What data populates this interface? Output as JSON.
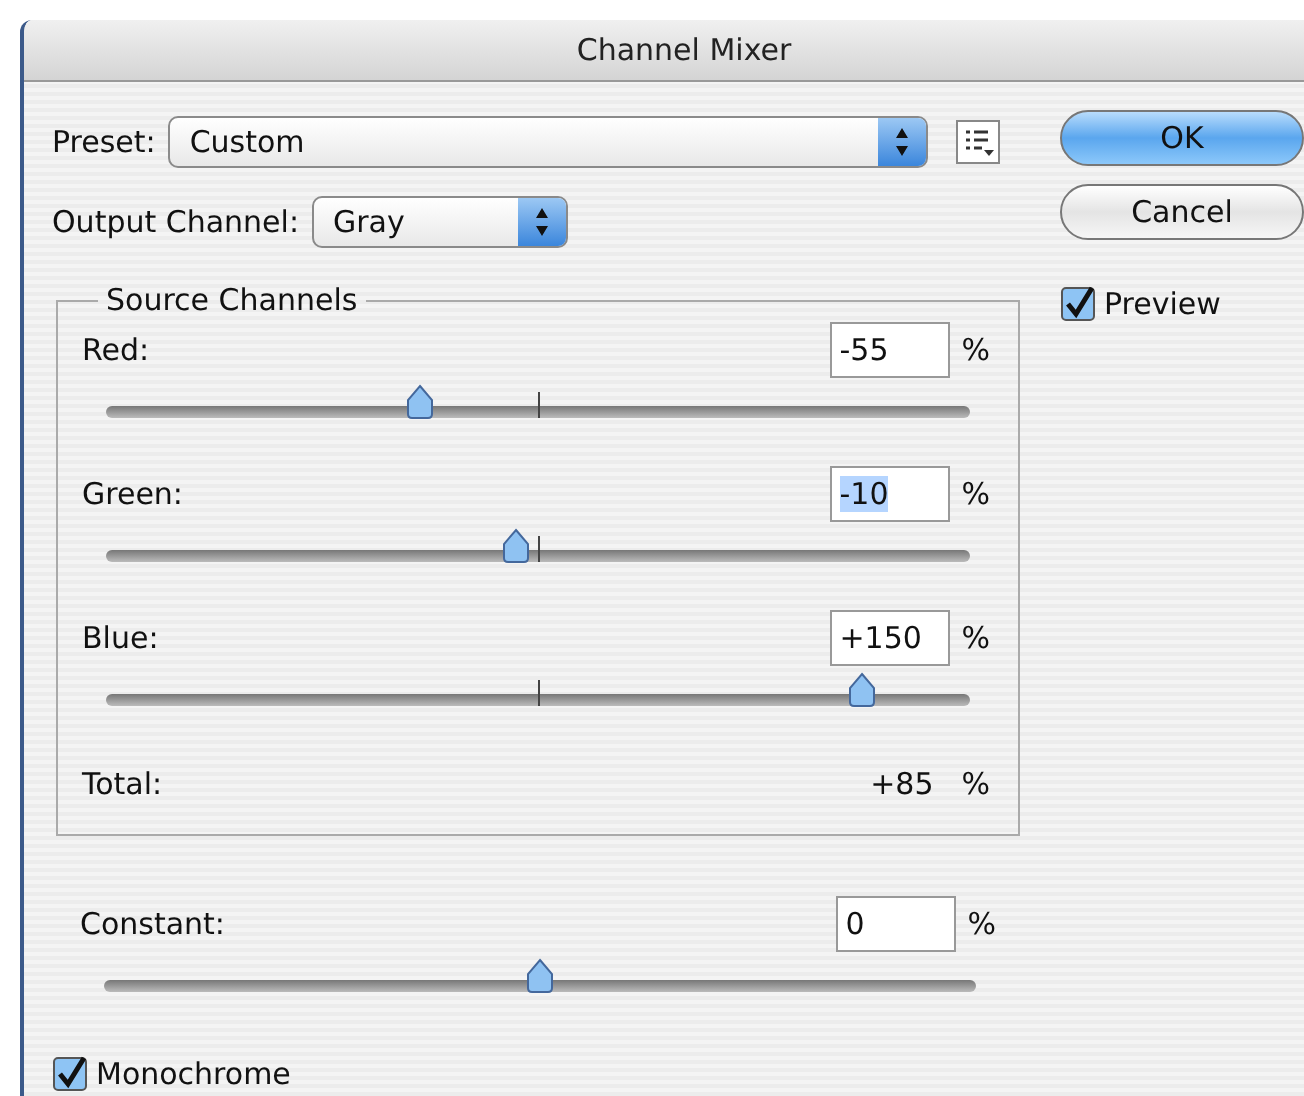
{
  "window": {
    "title": "Channel Mixer"
  },
  "preset": {
    "label": "Preset:",
    "value": "Custom"
  },
  "output_channel": {
    "label": "Output Channel:",
    "value": "Gray"
  },
  "buttons": [
    {
      "label": "OK",
      "default": true
    },
    {
      "label": "Cancel",
      "default": false
    }
  ],
  "preview": {
    "label": "Preview",
    "checked": true
  },
  "source_channels": {
    "title": "Source Channels",
    "channels": [
      {
        "name": "Red:",
        "value": "-55",
        "unit": "%",
        "level": 0.3625,
        "selected": false
      },
      {
        "name": "Green:",
        "value": "-10",
        "unit": "%",
        "level": 0.475,
        "selected": true
      },
      {
        "name": "Blue:",
        "value": "+150",
        "unit": "%",
        "level": 0.875,
        "selected": false
      }
    ],
    "total": {
      "label": "Total:",
      "value": "+85",
      "unit": "%"
    }
  },
  "constant": {
    "name": "Constant:",
    "value": "0",
    "unit": "%",
    "level": 0.5
  },
  "monochrome": {
    "label": "Monochrome",
    "checked": true
  }
}
